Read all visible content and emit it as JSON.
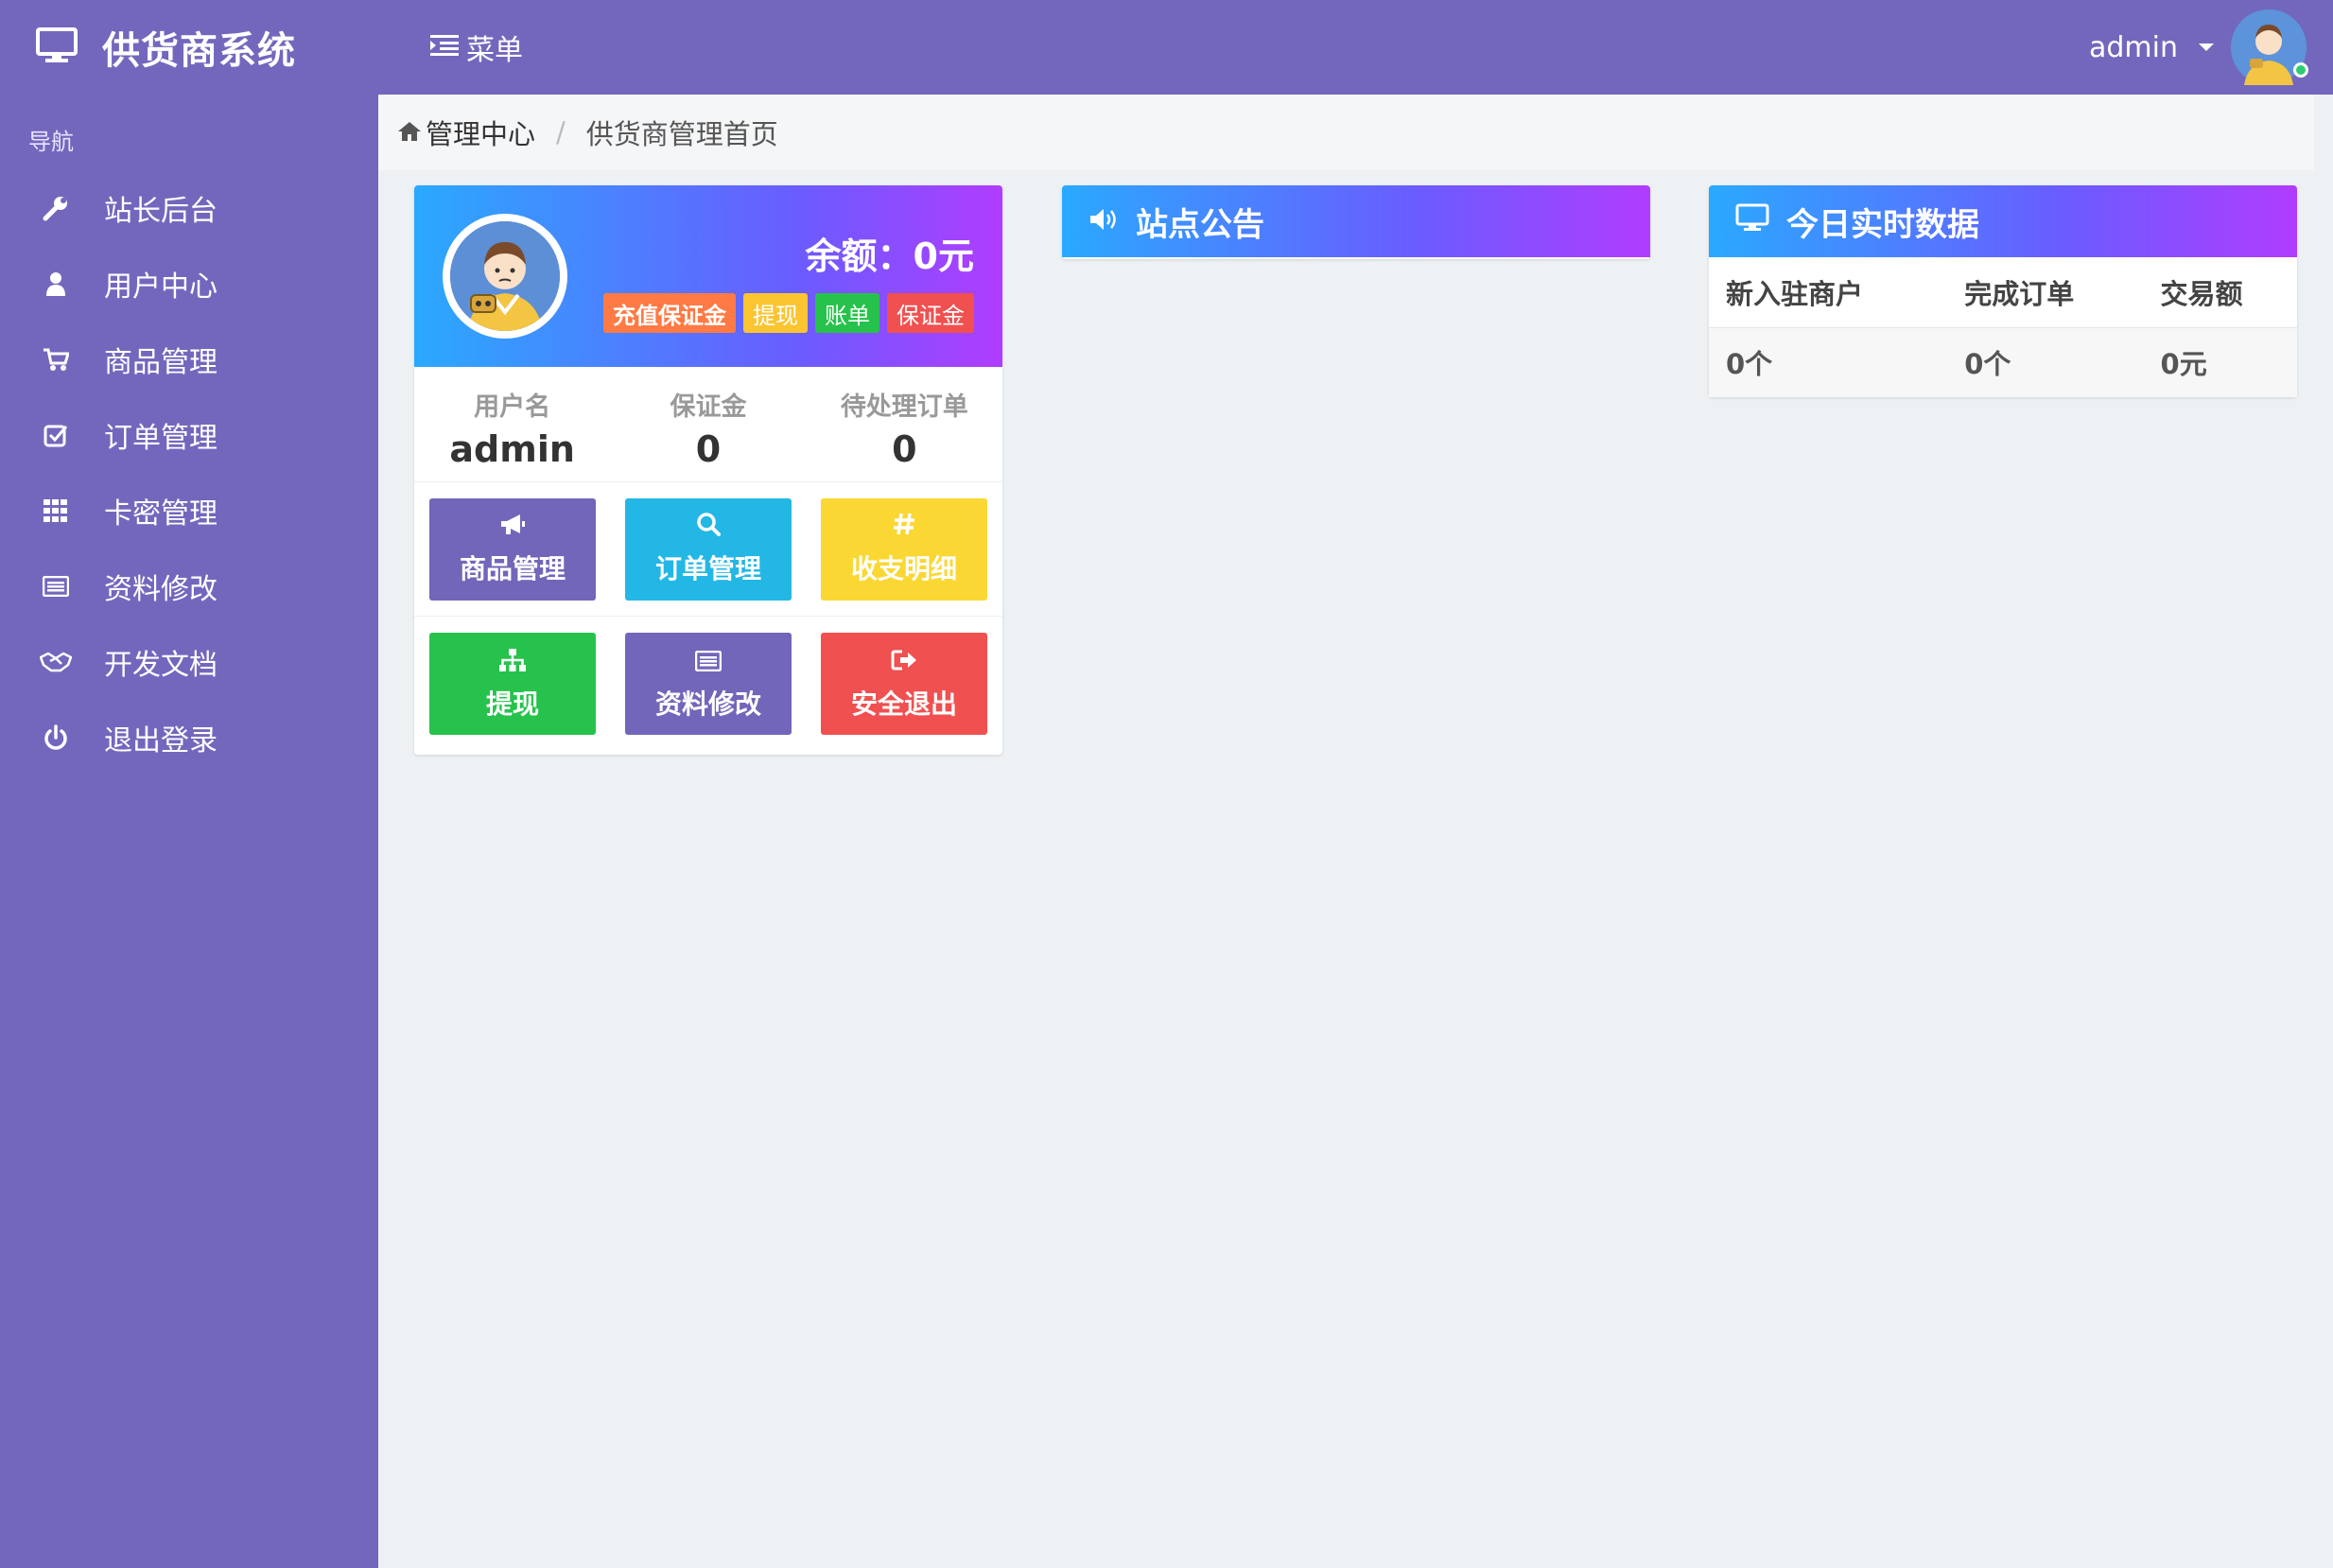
{
  "topbar": {
    "brand_title": "供货商系统",
    "menu_label": "菜单",
    "user_name": "admin"
  },
  "sidebar": {
    "header": "导航",
    "items": [
      {
        "label": "站长后台",
        "icon": "wrench-icon"
      },
      {
        "label": "用户中心",
        "icon": "user-icon"
      },
      {
        "label": "商品管理",
        "icon": "cart-icon"
      },
      {
        "label": "订单管理",
        "icon": "checkbox-icon"
      },
      {
        "label": "卡密管理",
        "icon": "grid-icon"
      },
      {
        "label": "资料修改",
        "icon": "card-icon"
      },
      {
        "label": "开发文档",
        "icon": "handshake-icon"
      },
      {
        "label": "退出登录",
        "icon": "power-icon"
      }
    ]
  },
  "breadcrumb": {
    "home": "管理中心",
    "current": "供货商管理首页"
  },
  "profile": {
    "balance": "余额：0元",
    "badges": [
      {
        "label": "充值保证金",
        "color": "#ff7a45"
      },
      {
        "label": "提现",
        "color": "#fbc531"
      },
      {
        "label": "账单",
        "color": "#27c24c"
      },
      {
        "label": "保证金",
        "color": "#f05050"
      }
    ],
    "stats": [
      {
        "label": "用户名",
        "value": "admin"
      },
      {
        "label": "保证金",
        "value": "0"
      },
      {
        "label": "待处理订单",
        "value": "0"
      }
    ],
    "buttons": [
      {
        "label": "商品管理",
        "icon": "bullhorn-icon",
        "color": "#7266ba"
      },
      {
        "label": "订单管理",
        "icon": "search-icon",
        "color": "#23b7e5"
      },
      {
        "label": "收支明细",
        "icon": "hash-icon",
        "color": "#fad733"
      },
      {
        "label": "提现",
        "icon": "sitemap-icon",
        "color": "#27c24c"
      },
      {
        "label": "资料修改",
        "icon": "card-icon",
        "color": "#7266ba"
      },
      {
        "label": "安全退出",
        "icon": "logout-icon",
        "color": "#f05050"
      }
    ]
  },
  "notice": {
    "title": "站点公告"
  },
  "today": {
    "title": "今日实时数据",
    "headers": [
      "新入驻商户",
      "完成订单",
      "交易额"
    ],
    "values": [
      "0个",
      "0个",
      "0元"
    ]
  }
}
